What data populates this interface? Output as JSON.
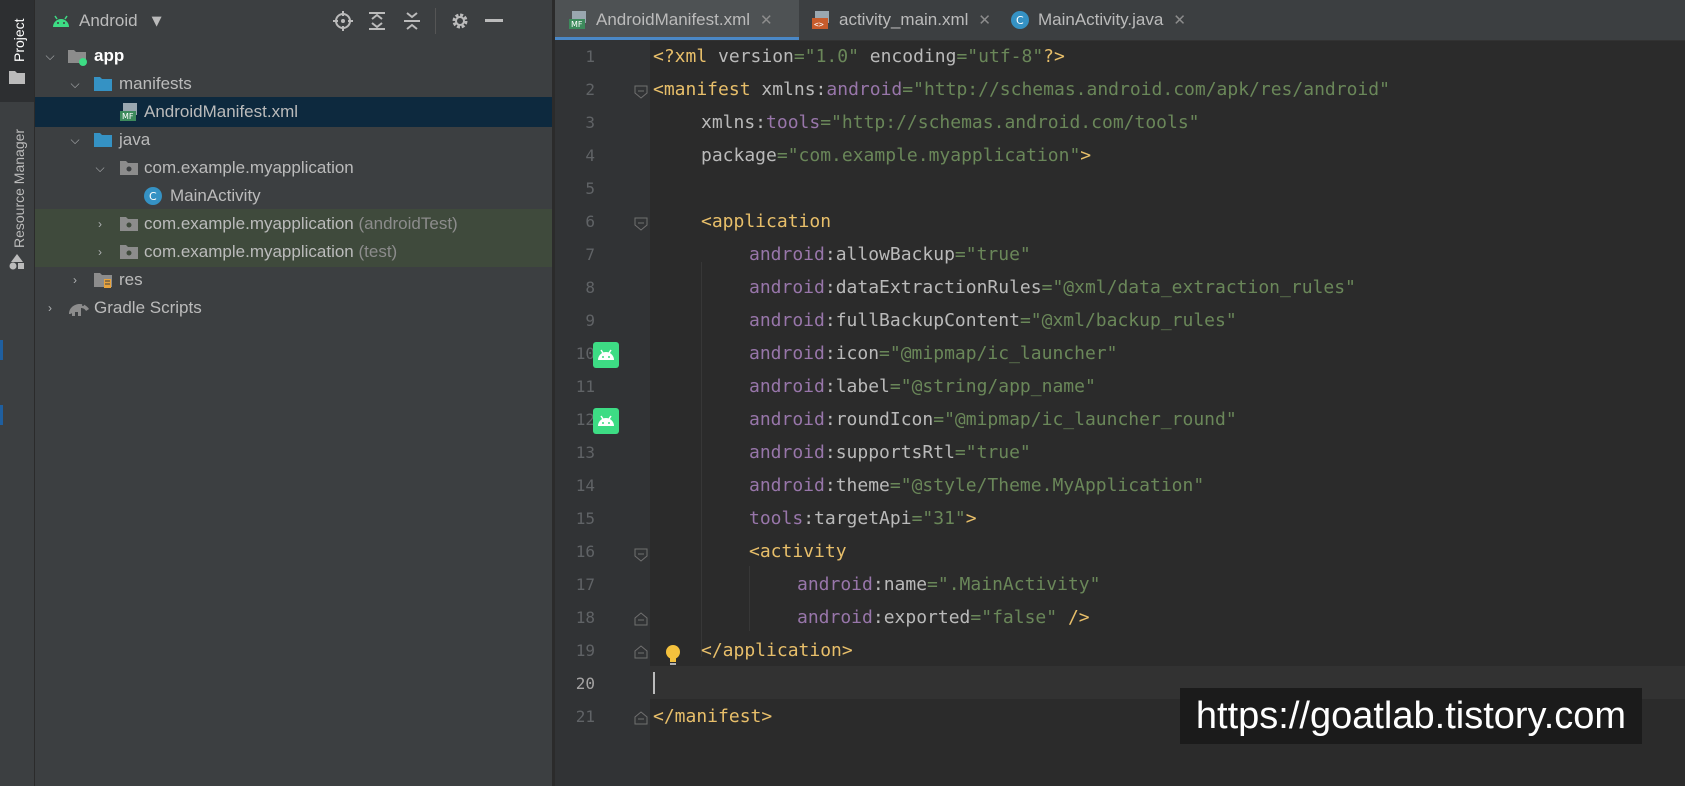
{
  "side_stripe": {
    "project_label": "Project",
    "resource_manager_label": "Resource Manager"
  },
  "project_panel": {
    "view_selector": "Android",
    "tree": [
      {
        "label": "app",
        "bold": true
      },
      {
        "label": "manifests"
      },
      {
        "label": "AndroidManifest.xml",
        "selected": true
      },
      {
        "label": "java"
      },
      {
        "label": "com.example.myapplication"
      },
      {
        "label": "MainActivity"
      },
      {
        "label": "com.example.myapplication",
        "suffix": "(androidTest)"
      },
      {
        "label": "com.example.myapplication",
        "suffix": "(test)"
      },
      {
        "label": "res"
      },
      {
        "label": "Gradle Scripts"
      }
    ]
  },
  "editor": {
    "tabs": [
      {
        "label": "AndroidManifest.xml",
        "active": true
      },
      {
        "label": "activity_main.xml",
        "active": false
      },
      {
        "label": "MainActivity.java",
        "active": false
      }
    ],
    "line_numbers": [
      "1",
      "2",
      "3",
      "4",
      "5",
      "6",
      "7",
      "8",
      "9",
      "10",
      "11",
      "12",
      "13",
      "14",
      "15",
      "16",
      "17",
      "18",
      "19",
      "20",
      "21"
    ],
    "code": {
      "l1": {
        "a": "<?xml ",
        "b": "version",
        "c": "=\"1.0\"",
        "d": " encoding",
        "e": "=\"utf-8\"",
        "f": "?>"
      },
      "l2": {
        "a": "<manifest ",
        "b": "xmlns:",
        "c": "android",
        "d": "=\"http://schemas.android.com/apk/res/android\""
      },
      "l3": {
        "b": "xmlns:",
        "c": "tools",
        "d": "=\"http://schemas.android.com/tools\""
      },
      "l4": {
        "b": "package",
        "d": "=\"com.example.myapplication\"",
        "e": ">"
      },
      "l6": {
        "a": "<application"
      },
      "l7": {
        "ns": "android",
        "attr": ":allowBackup",
        "val": "=\"true\""
      },
      "l8": {
        "ns": "android",
        "attr": ":dataExtractionRules",
        "val": "=\"@xml/data_extraction_rules\""
      },
      "l9": {
        "ns": "android",
        "attr": ":fullBackupContent",
        "val": "=\"@xml/backup_rules\""
      },
      "l10": {
        "ns": "android",
        "attr": ":icon",
        "val": "=\"@mipmap/ic_launcher\""
      },
      "l11": {
        "ns": "android",
        "attr": ":label",
        "val": "=\"@string/app_name\""
      },
      "l12": {
        "ns": "android",
        "attr": ":roundIcon",
        "val": "=\"@mipmap/ic_launcher_round\""
      },
      "l13": {
        "ns": "android",
        "attr": ":supportsRtl",
        "val": "=\"true\""
      },
      "l14": {
        "ns": "android",
        "attr": ":theme",
        "val": "=\"@style/Theme.MyApplication\""
      },
      "l15": {
        "ns": "tools",
        "attr": ":targetApi",
        "val": "=\"31\"",
        "end": ">"
      },
      "l16": {
        "a": "<activity"
      },
      "l17": {
        "ns": "android",
        "attr": ":name",
        "val": "=\".MainActivity\""
      },
      "l18": {
        "ns": "android",
        "attr": ":exported",
        "val": "=\"false\"",
        "end": " />"
      },
      "l19": {
        "a": "</application>"
      },
      "l21": {
        "a": "</manifest>"
      }
    }
  },
  "watermark": "https://goatlab.tistory.com",
  "colors": {
    "tag": "#e8bf6a",
    "namespace": "#9876aa",
    "value": "#6a8759",
    "attribute": "#bababa",
    "selection": "#0d293e",
    "test_folder": "#3f4a3c",
    "android_green": "#3ddc84"
  }
}
